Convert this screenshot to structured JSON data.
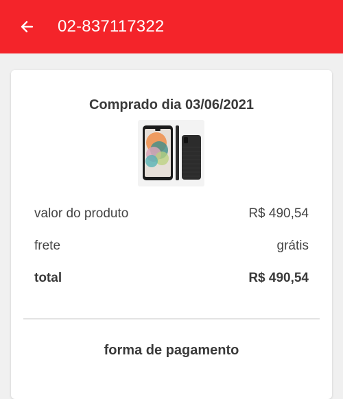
{
  "header": {
    "title": "02-837117322",
    "back_icon": "arrow-left-icon",
    "background_color": "#f4242a"
  },
  "order": {
    "purchase_date_label": "Comprado dia 03/06/2021",
    "product_image": "smartphone-image",
    "rows": [
      {
        "label": "valor do produto",
        "value": "R$ 490,54"
      },
      {
        "label": "frete",
        "value": "grátis"
      },
      {
        "label": "total",
        "value": "R$ 490,54"
      }
    ],
    "payment_heading": "forma de pagamento"
  }
}
